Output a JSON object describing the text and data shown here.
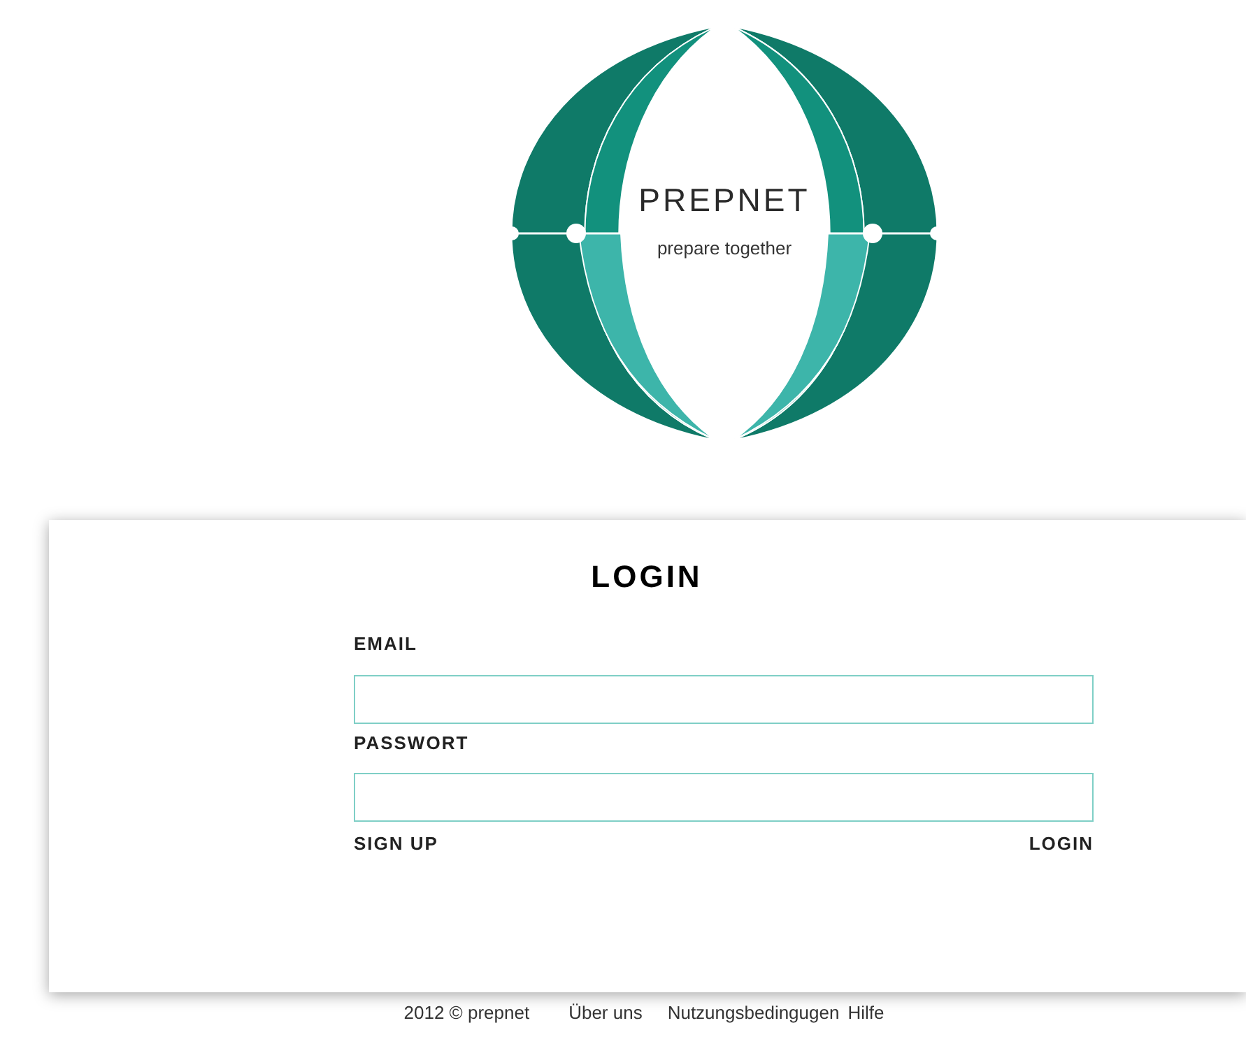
{
  "logo": {
    "name": "PREPNET",
    "tagline": "prepare together"
  },
  "login": {
    "title": "LOGIN",
    "fields": [
      {
        "label": "EMAIL"
      },
      {
        "label": "PASSWORT"
      }
    ],
    "signup_link": "SIGN UP",
    "login_link": "LOGIN"
  },
  "footer": {
    "copyright": "2012 © prepnet",
    "links": [
      "Über uns",
      "Nutzungsbedingugen",
      "Hilfe"
    ]
  }
}
